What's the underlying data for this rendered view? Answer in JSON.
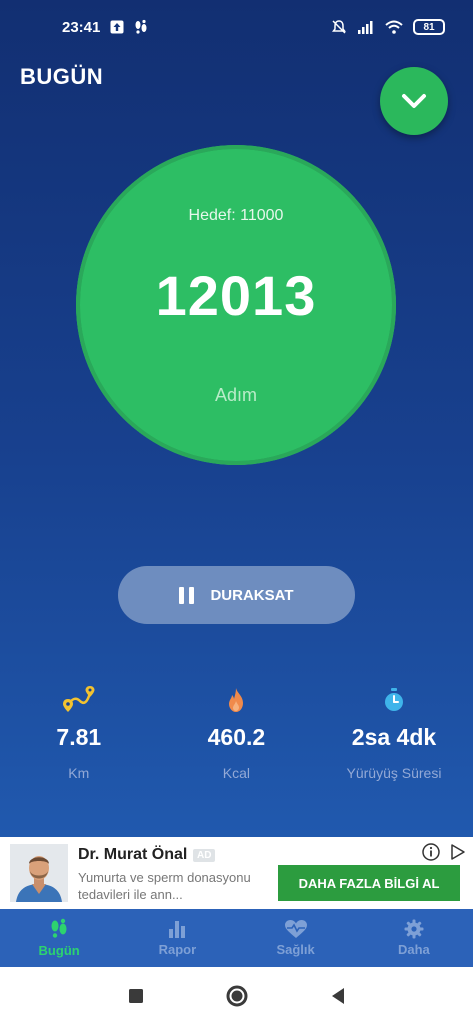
{
  "status_bar": {
    "time": "23:41",
    "battery": "81",
    "icons": [
      "upload-icon",
      "footsteps-icon",
      "mute-icon",
      "signal-icon",
      "wifi-icon",
      "battery-icon"
    ]
  },
  "header": {
    "title": "BUGÜN",
    "expand_icon": "chevron-down-icon"
  },
  "step_circle": {
    "goal_label": "Hedef: 11000",
    "steps": "12013",
    "unit": "Adım",
    "goal_progress": 1.0
  },
  "pause_button": {
    "label": "DURAKSAT",
    "icon": "pause-icon"
  },
  "stats": [
    {
      "icon": "route-pin-icon",
      "value": "7.81",
      "label": "Km"
    },
    {
      "icon": "flame-icon",
      "value": "460.2",
      "label": "Kcal"
    },
    {
      "icon": "stopwatch-icon",
      "value": "2sa 4dk",
      "label": "Yürüyüş Süresi"
    }
  ],
  "ad": {
    "title": "Dr. Murat Önal",
    "badge": "AD",
    "body": "Yumurta ve sperm donasyonu tedavileri ile ann...",
    "cta": "DAHA FAZLA BİLGİ AL"
  },
  "nav": [
    {
      "label": "Bugün",
      "icon": "footsteps-icon",
      "active": true
    },
    {
      "label": "Rapor",
      "icon": "bar-chart-icon",
      "active": false
    },
    {
      "label": "Sağlık",
      "icon": "heart-pulse-icon",
      "active": false
    },
    {
      "label": "Daha",
      "icon": "gear-icon",
      "active": false
    }
  ],
  "colors": {
    "accent_green": "#2dbe64",
    "background_top": "#122f72",
    "background_bottom": "#2563b6",
    "active_nav": "#2dd36f"
  }
}
